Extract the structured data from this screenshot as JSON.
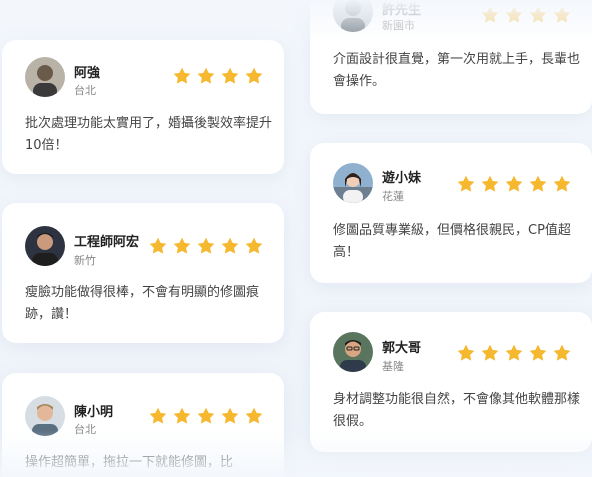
{
  "colors": {
    "star": "#f5b82e",
    "background": "#f3f7fc",
    "card": "#ffffff"
  },
  "reviews_left": [
    {
      "name": "阿強",
      "location": "台北",
      "rating": 4,
      "text": "批次處理功能太實用了，婚攝後製效率提升10倍！"
    },
    {
      "name": "工程師阿宏",
      "location": "新竹",
      "rating": 5,
      "text": "瘦臉功能做得很棒，不會有明顯的修圖痕跡，讚！"
    },
    {
      "name": "陳小明",
      "location": "台北",
      "rating": 5,
      "text": "操作超簡單，拖拉一下就能修圖，比"
    }
  ],
  "reviews_right": [
    {
      "name": "許先生",
      "location": "新園市",
      "rating": 4,
      "text": "介面設計很直覺，第一次用就上手，長輩也會操作。"
    },
    {
      "name": "遊小妹",
      "location": "花蓮",
      "rating": 5,
      "text": "修圖品質專業級，但價格很親民，CP值超高！"
    },
    {
      "name": "郭大哥",
      "location": "基隆",
      "rating": 5,
      "text": "身材調整功能很自然，不會像其他軟體那樣很假。"
    }
  ]
}
